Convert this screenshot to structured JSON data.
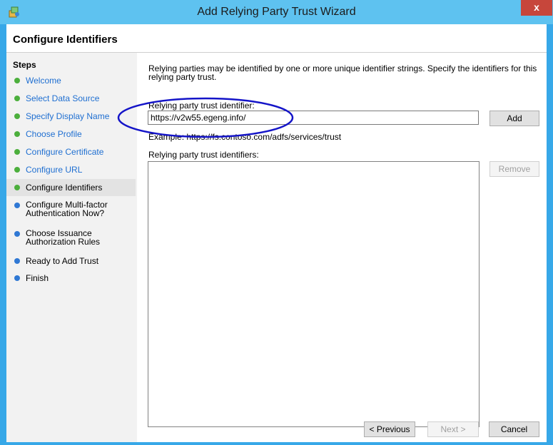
{
  "window": {
    "title": "Add Relying Party Trust Wizard",
    "close_glyph": "x",
    "title_bar_color": "#5ec2f0",
    "close_color": "#c7463b"
  },
  "header": {
    "title": "Configure Identifiers"
  },
  "sidebar": {
    "steps_label": "Steps",
    "items": [
      {
        "label": "Welcome",
        "state": "done"
      },
      {
        "label": "Select Data Source",
        "state": "done"
      },
      {
        "label": "Specify Display Name",
        "state": "done"
      },
      {
        "label": "Choose Profile",
        "state": "done"
      },
      {
        "label": "Configure Certificate",
        "state": "done"
      },
      {
        "label": "Configure URL",
        "state": "done"
      },
      {
        "label": "Configure Identifiers",
        "state": "current"
      },
      {
        "label": "Configure Multi-factor Authentication Now?",
        "line1": "Configure Multi-factor",
        "line2": "Authentication Now?",
        "state": "pending"
      },
      {
        "label": "Choose Issuance Authorization Rules",
        "line1": "Choose Issuance",
        "line2": "Authorization Rules",
        "state": "pending"
      },
      {
        "label": "Ready to Add Trust",
        "state": "pending"
      },
      {
        "label": "Finish",
        "state": "pending"
      }
    ],
    "done_color": "#4caf3c",
    "pending_color": "#2f78d4"
  },
  "main": {
    "description": "Relying parties may be identified by one or more unique identifier strings. Specify the identifiers for this relying party trust.",
    "identifier_label": "Relying party trust identifier:",
    "identifier_value": "https://v2w55.egeng.info/",
    "add_label": "Add",
    "example_text": "Example: https://fs.contoso.com/adfs/services/trust",
    "identifiers_label": "Relying party trust identifiers:",
    "identifiers": [],
    "remove_label": "Remove"
  },
  "footer": {
    "previous_label": "< Previous",
    "next_label": "Next >",
    "cancel_label": "Cancel"
  },
  "annotation": {
    "shape": "ellipse",
    "color": "#1414c8"
  }
}
